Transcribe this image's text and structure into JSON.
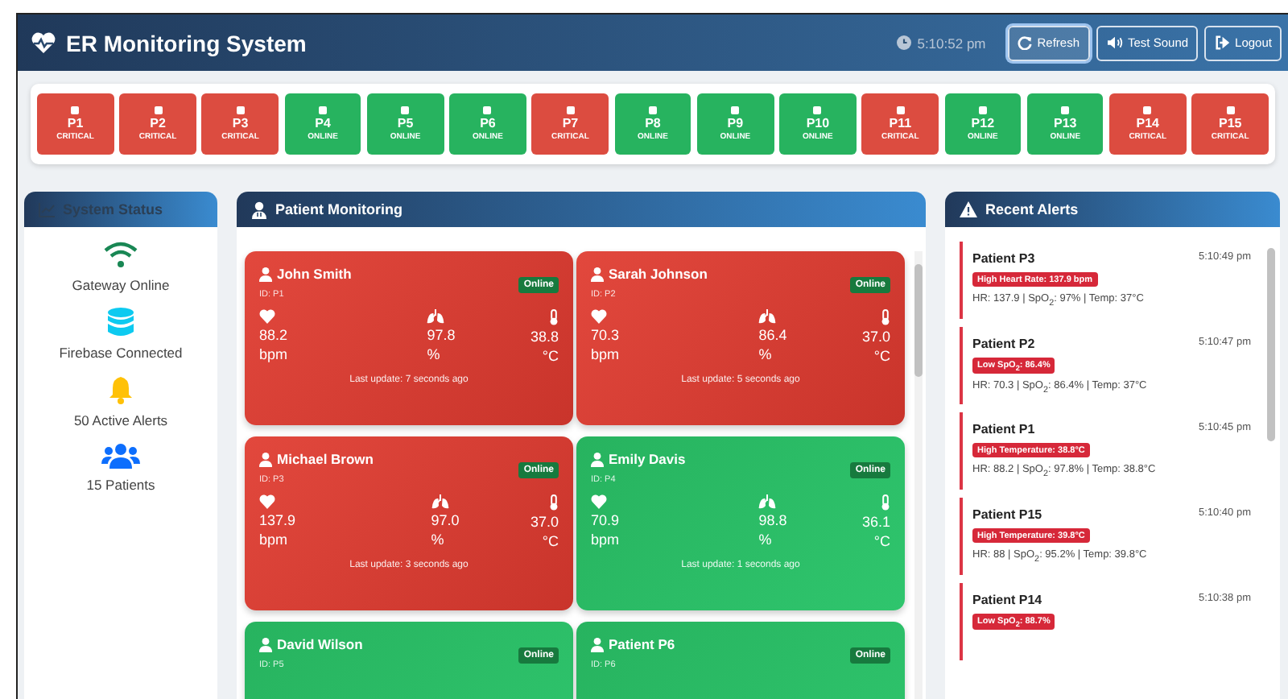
{
  "header": {
    "title": "ER Monitoring System",
    "time": "5:10:52 pm",
    "buttons": [
      {
        "label": "Refresh",
        "kind": "refresh",
        "selected": true
      },
      {
        "label": "Test Sound",
        "kind": "sound",
        "selected": false
      },
      {
        "label": "Logout",
        "kind": "logout",
        "selected": false
      }
    ]
  },
  "patient_tiles": [
    {
      "id": "P1",
      "status": "CRITICAL",
      "kind": "critical"
    },
    {
      "id": "P2",
      "status": "CRITICAL",
      "kind": "critical"
    },
    {
      "id": "P3",
      "status": "CRITICAL",
      "kind": "critical"
    },
    {
      "id": "P4",
      "status": "ONLINE",
      "kind": "online"
    },
    {
      "id": "P5",
      "status": "ONLINE",
      "kind": "online"
    },
    {
      "id": "P6",
      "status": "ONLINE",
      "kind": "online"
    },
    {
      "id": "P7",
      "status": "CRITICAL",
      "kind": "critical"
    },
    {
      "id": "P8",
      "status": "ONLINE",
      "kind": "online"
    },
    {
      "id": "P9",
      "status": "ONLINE",
      "kind": "online"
    },
    {
      "id": "P10",
      "status": "ONLINE",
      "kind": "online"
    },
    {
      "id": "P11",
      "status": "CRITICAL",
      "kind": "critical"
    },
    {
      "id": "P12",
      "status": "ONLINE",
      "kind": "online"
    },
    {
      "id": "P13",
      "status": "ONLINE",
      "kind": "online"
    },
    {
      "id": "P14",
      "status": "CRITICAL",
      "kind": "critical"
    },
    {
      "id": "P15",
      "status": "CRITICAL",
      "kind": "critical"
    }
  ],
  "system_status": {
    "title": "System Status",
    "items": [
      {
        "label": "Gateway Online",
        "kind": "wifi",
        "color": "#198754"
      },
      {
        "label": "Firebase Connected",
        "kind": "database",
        "color": "#0dcaf0"
      },
      {
        "label": "50 Active Alerts",
        "kind": "bell",
        "color": "#ffc107"
      },
      {
        "label": "15 Patients",
        "kind": "users",
        "color": "#0d6efd"
      }
    ]
  },
  "patient_monitoring": {
    "title": "Patient Monitoring",
    "cards": [
      {
        "name": "John Smith",
        "id": "ID: P1",
        "status": "Online",
        "kind": "critical",
        "vitals": [
          {
            "kind": "heart",
            "value": "88.2",
            "unit": "bpm"
          },
          {
            "kind": "lungs",
            "value": "97.8",
            "unit": "%"
          },
          {
            "kind": "temp",
            "value": "38.8",
            "unit": "°C"
          }
        ],
        "last_update": "Last update: 7 seconds ago"
      },
      {
        "name": "Sarah Johnson",
        "id": "ID: P2",
        "status": "Online",
        "kind": "critical",
        "vitals": [
          {
            "kind": "heart",
            "value": "70.3",
            "unit": "bpm"
          },
          {
            "kind": "lungs",
            "value": "86.4",
            "unit": "%"
          },
          {
            "kind": "temp",
            "value": "37.0",
            "unit": "°C"
          }
        ],
        "last_update": "Last update: 5 seconds ago"
      },
      {
        "name": "Michael Brown",
        "id": "ID: P3",
        "status": "Online",
        "kind": "critical",
        "vitals": [
          {
            "kind": "heart",
            "value": "137.9",
            "unit": "bpm"
          },
          {
            "kind": "lungs",
            "value": "97.0",
            "unit": "%"
          },
          {
            "kind": "temp",
            "value": "37.0",
            "unit": "°C"
          }
        ],
        "last_update": "Last update: 3 seconds ago"
      },
      {
        "name": "Emily Davis",
        "id": "ID: P4",
        "status": "Online",
        "kind": "online",
        "vitals": [
          {
            "kind": "heart",
            "value": "70.9",
            "unit": "bpm"
          },
          {
            "kind": "lungs",
            "value": "98.8",
            "unit": "%"
          },
          {
            "kind": "temp",
            "value": "36.1",
            "unit": "°C"
          }
        ],
        "last_update": "Last update: 1 seconds ago"
      },
      {
        "name": "David Wilson",
        "id": "ID: P5",
        "status": "Online",
        "kind": "online"
      },
      {
        "name": "Patient P6",
        "id": "ID: P6",
        "status": "Online",
        "kind": "online"
      }
    ]
  },
  "recent_alerts": {
    "title": "Recent Alerts",
    "items": [
      {
        "patient": "Patient P3",
        "time": "5:10:49 pm",
        "alert": "High Heart Rate: 137.9 bpm",
        "detail": "HR: 137.9 | SpO$_{2}$: 97% | Temp: 37°C"
      },
      {
        "patient": "Patient P2",
        "time": "5:10:47 pm",
        "alert": "Low SpO$_{2}$: 86.4%",
        "detail": "HR: 70.3 | SpO$_{2}$: 86.4% | Temp: 37°C"
      },
      {
        "patient": "Patient P1",
        "time": "5:10:45 pm",
        "alert": "High Temperature: 38.8°C",
        "detail": "HR: 88.2 | SpO$_{2}$: 97.8% | Temp: 38.8°C"
      },
      {
        "patient": "Patient P15",
        "time": "5:10:40 pm",
        "alert": "High Temperature: 39.8°C",
        "detail": "HR: 88 | SpO$_{2}$: 95.2% | Temp: 39.8°C"
      },
      {
        "patient": "Patient P14",
        "time": "5:10:38 pm",
        "alert": "Low SpO$_{2}$: 88.7%"
      }
    ]
  }
}
